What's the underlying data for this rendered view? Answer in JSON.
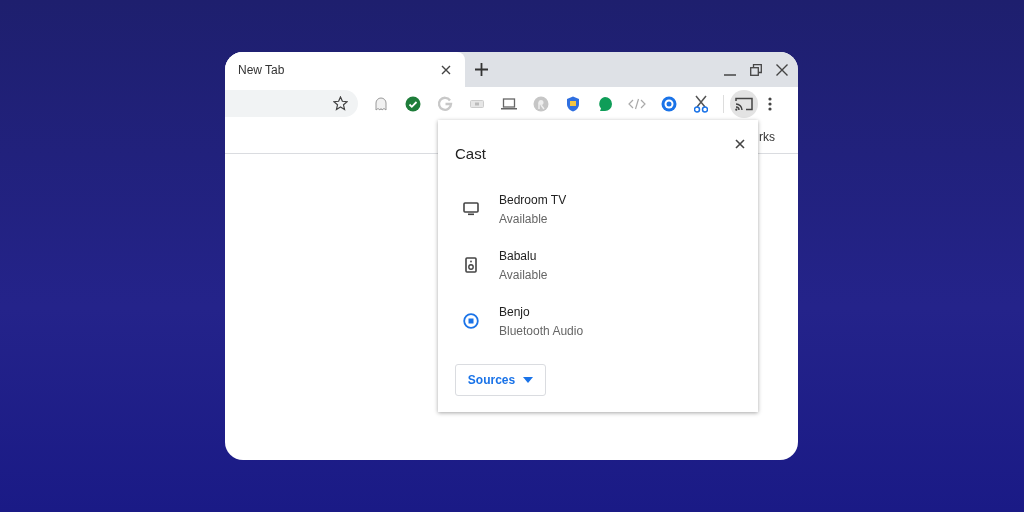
{
  "tab": {
    "title": "New Tab",
    "selected": true
  },
  "bookmarks_bar": {
    "text": "rks"
  },
  "cast_dialog": {
    "title": "Cast",
    "sources_button": "Sources",
    "devices": [
      {
        "name": "Bedroom TV",
        "status": "Available",
        "kind": "tv"
      },
      {
        "name": "Babalu",
        "status": "Available",
        "kind": "speaker"
      },
      {
        "name": "Benjo",
        "status": "Bluetooth Audio",
        "kind": "active"
      }
    ]
  }
}
